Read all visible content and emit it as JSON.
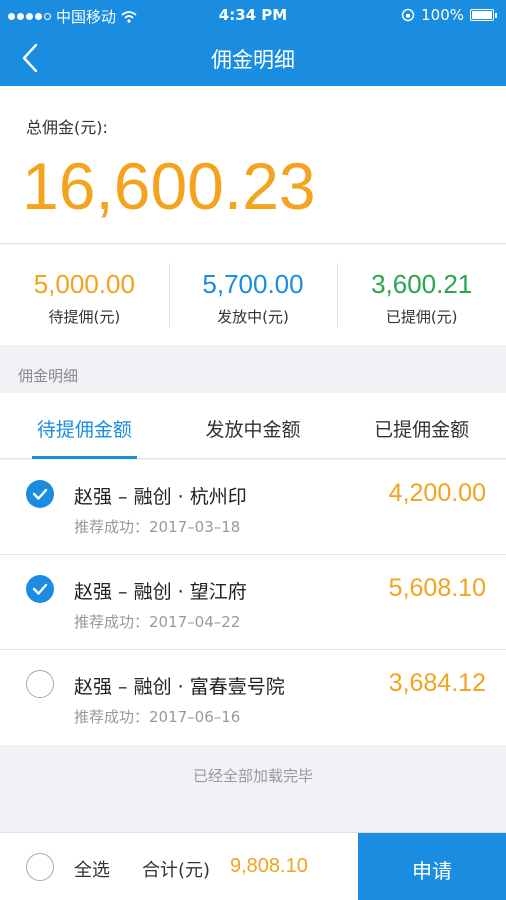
{
  "status_bar": {
    "carrier": "中国移动",
    "time": "4:34 PM",
    "battery": "100%"
  },
  "nav": {
    "title": "佣金明细"
  },
  "total": {
    "label": "总佣金(元):",
    "amount": "16,600.23"
  },
  "stats": [
    {
      "value": "5,000.00",
      "label": "待提佣(元)",
      "color": "#f3a31e"
    },
    {
      "value": "5,700.00",
      "label": "发放中(元)",
      "color": "#1a8de0"
    },
    {
      "value": "3,600.21",
      "label": "已提佣(元)",
      "color": "#2aa64a"
    }
  ],
  "section_label": "佣金明细",
  "tabs": [
    {
      "label": "待提佣金额",
      "active": true
    },
    {
      "label": "发放中金额",
      "active": false
    },
    {
      "label": "已提佣金额",
      "active": false
    }
  ],
  "items": [
    {
      "name": "赵强 – 融创 · 杭州印",
      "date": "推荐成功：2017–03–18",
      "amount": "4,200.00",
      "checked": true
    },
    {
      "name": "赵强 – 融创 · 望江府",
      "date": "推荐成功：2017–04–22",
      "amount": "5,608.10",
      "checked": true
    },
    {
      "name": "赵强 – 融创 · 富春壹号院",
      "date": "推荐成功：2017–06–16",
      "amount": "3,684.12",
      "checked": false
    }
  ],
  "loaded_text": "已经全部加载完毕",
  "footer": {
    "select_all": "全选",
    "sum_label": "合计(元)",
    "sum_value": "9,808.10",
    "apply_label": "申请"
  }
}
